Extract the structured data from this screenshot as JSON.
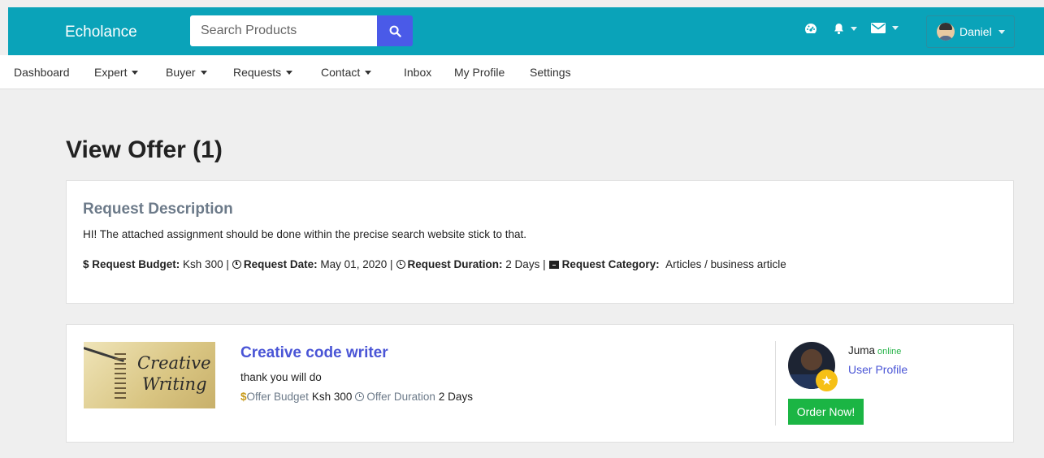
{
  "header": {
    "brand": "Echolance",
    "search_placeholder": "Search Products",
    "user_name": "Daniel"
  },
  "nav": {
    "items": [
      {
        "label": "Dashboard"
      },
      {
        "label": "Expert"
      },
      {
        "label": "Buyer"
      },
      {
        "label": "Requests"
      },
      {
        "label": "Contact"
      },
      {
        "label": "Inbox"
      },
      {
        "label": "My Profile"
      },
      {
        "label": "Settings"
      }
    ]
  },
  "page": {
    "title": "View Offer (1)"
  },
  "request": {
    "heading": "Request Description",
    "description": "HI! The attached assignment should be done within the precise search website stick to that.",
    "budget_label": "Request Budget:",
    "budget_value": "Ksh 300",
    "date_label": "Request Date:",
    "date_value": "May 01, 2020",
    "duration_label": "Request Duration:",
    "duration_value": "2 Days",
    "category_label": "Request Category:",
    "category_value": "Articles / business article",
    "separator": "|",
    "currency_symbol": "$"
  },
  "offer": {
    "image_text_line1": "Creative",
    "image_text_line2": "Writing",
    "title": "Creative code writer",
    "message": "thank you will do",
    "currency_symbol": "$",
    "budget_label": "Offer Budget",
    "budget_value": "Ksh 300",
    "duration_label": "Offer Duration",
    "duration_value": "2 Days",
    "seller_name": "Juma",
    "seller_status": "online",
    "profile_link": "User Profile",
    "order_button": "Order Now!"
  },
  "colors": {
    "header_bg": "#0aa3b9",
    "search_button": "#4a5ae8",
    "link": "#4a55d6",
    "order_button": "#1bb544",
    "online": "#28b34a",
    "badge": "#f6c016"
  }
}
